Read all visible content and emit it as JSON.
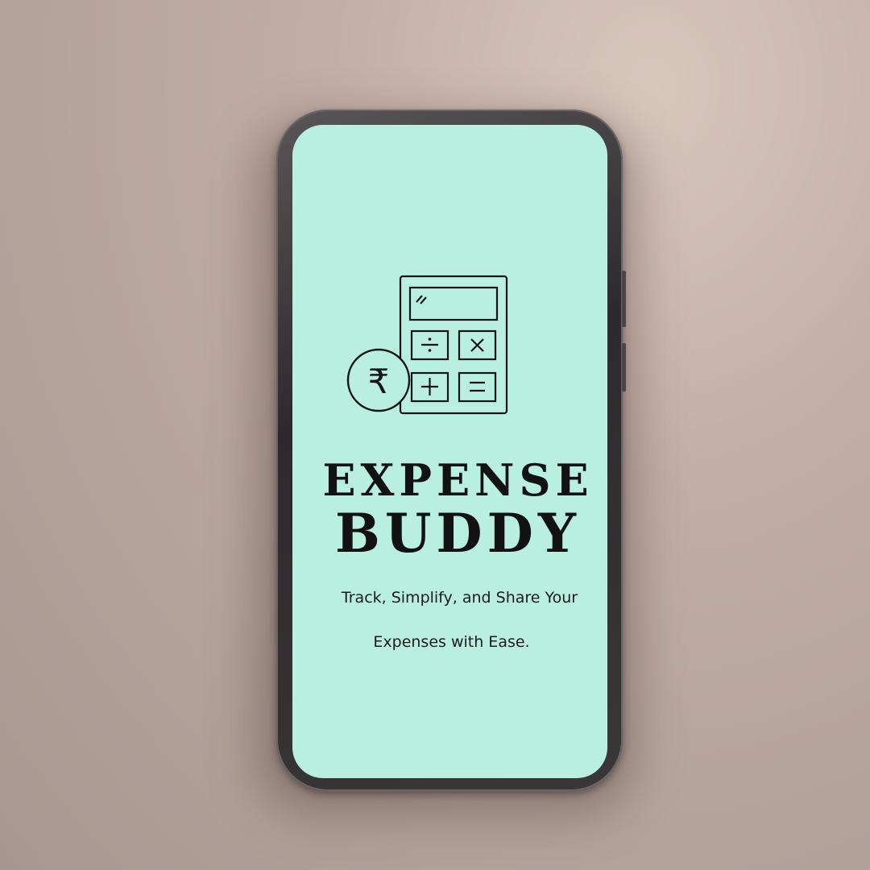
{
  "app": {
    "title_line1": "EXPENSE",
    "title_line2": "BUDDY",
    "tagline_line1": "Track, Simplify, and Share Your",
    "tagline_line2": "Expenses with Ease."
  },
  "logo": {
    "icon_names": [
      "calculator-icon",
      "rupee-coin-icon"
    ],
    "calculator_keys": [
      "÷",
      "×",
      "+",
      "="
    ],
    "currency_symbol": "₹"
  },
  "colors": {
    "screen_background": "#b9efdf",
    "text": "#121212",
    "phone_frame": "#2c2a2c",
    "backdrop": "#c2aea6"
  }
}
